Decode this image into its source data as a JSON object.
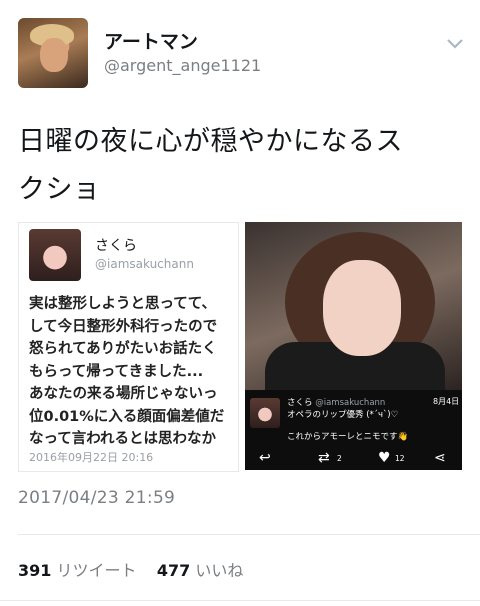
{
  "author": {
    "name": "アートマン",
    "handle": "@argent_ange1121"
  },
  "tweet": {
    "text_line1": "日曜の夜に心が穏やかになるス",
    "text_line2": "クショ",
    "timestamp": "2017/04/23 21:59"
  },
  "card_left": {
    "name": "さくら",
    "handle": "@iamsakuchann",
    "lines": [
      "実は整形しようと思ってて、",
      "して今日整形外科行ったので",
      "怒られてありがたいお話たく",
      "もらって帰ってきました...",
      "あなたの来る場所じゃないっ",
      "位0.01%に入る顔面偏差値だ",
      "なって言われるとは思わなか"
    ],
    "date": "2016年09月22日 20:16"
  },
  "card_right": {
    "name": "さくら",
    "handle": "@iamsakuchann",
    "date": "8月4日",
    "text1": "オペラのリップ優秀 (*´ч`)♡",
    "text2": "これからアモーレとニモです👋",
    "retweet_count": "2",
    "like_count": "12"
  },
  "stats": {
    "retweets": "391",
    "retweets_label": "リツイート",
    "likes": "477",
    "likes_label": "いいね"
  },
  "icons": {
    "chevron": "chevron-down-icon",
    "reply": "reply-icon",
    "retweet": "retweet-icon",
    "like": "heart-icon",
    "share": "share-icon"
  }
}
